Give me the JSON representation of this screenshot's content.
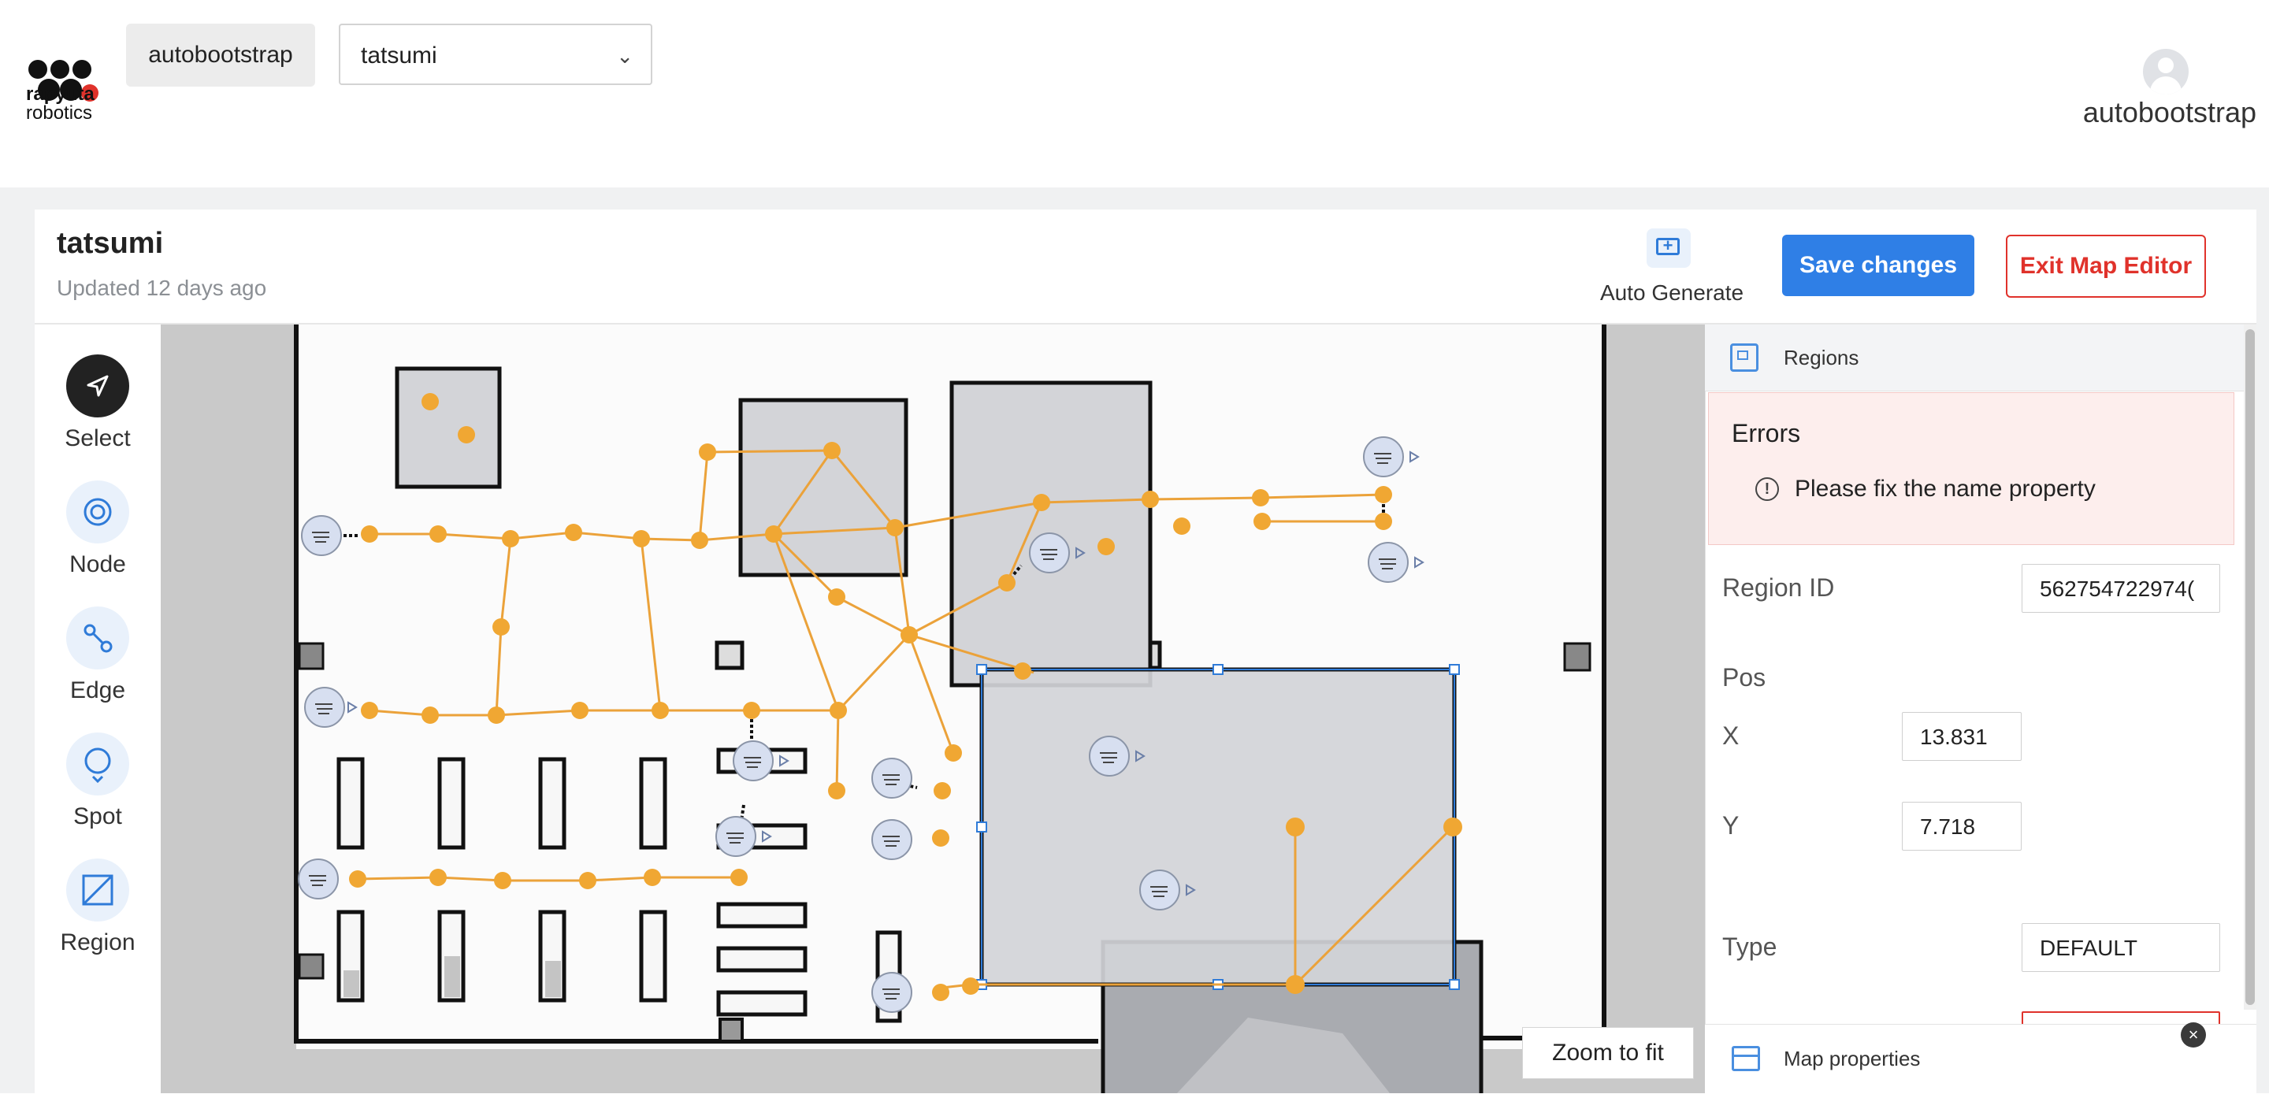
{
  "header": {
    "logo": {
      "line1": "rapyuta",
      "line2": "robotics"
    },
    "organization": "autobootstrap",
    "project_select": {
      "value": "tatsumi"
    },
    "user_name": "autobootstrap"
  },
  "editor": {
    "map_name": "tatsumi",
    "updated": "Updated 12 days ago",
    "auto_generate_label": "Auto Generate",
    "save_label": "Save changes",
    "exit_label": "Exit Map Editor",
    "zoom_to_fit_label": "Zoom to fit"
  },
  "toolbar": {
    "tools": [
      {
        "label": "Select",
        "icon": "navigation-arrow-icon",
        "active": true
      },
      {
        "label": "Node",
        "icon": "node-target-icon",
        "active": false
      },
      {
        "label": "Edge",
        "icon": "edge-link-icon",
        "active": false
      },
      {
        "label": "Spot",
        "icon": "spot-pin-icon",
        "active": false
      },
      {
        "label": "Region",
        "icon": "region-square-icon",
        "active": false
      }
    ]
  },
  "panel": {
    "section_title": "Regions",
    "errors_title": "Errors",
    "error_message": "Please fix the name property",
    "region_id_label": "Region ID",
    "region_id_value": "562754722974(",
    "pos_label": "Pos",
    "x_label": "X",
    "x_value": "13.831",
    "y_label": "Y",
    "y_value": "7.718",
    "type_label": "Type",
    "type_value": "DEFAULT",
    "map_properties_label": "Map properties"
  },
  "colors": {
    "primary": "#2f7fe6",
    "danger": "#e0322b",
    "node": "#f0a733",
    "edge": "#eba23a",
    "region_fill": "#d3d4d8",
    "selection": "#1e5fa8"
  }
}
